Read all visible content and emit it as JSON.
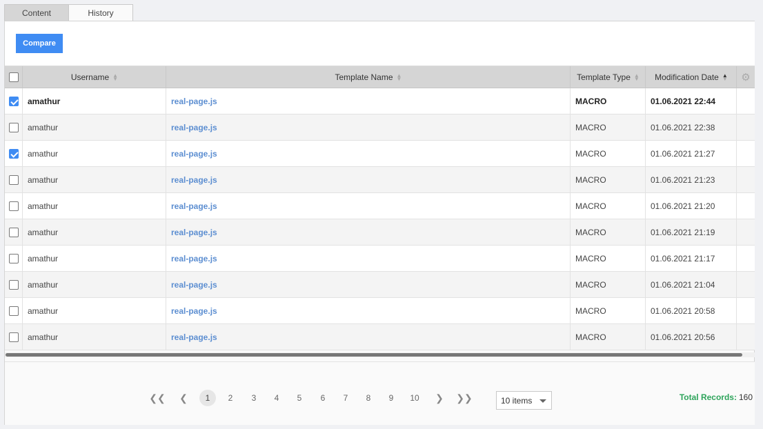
{
  "tabs": [
    {
      "label": "Content"
    },
    {
      "label": "History"
    }
  ],
  "toolbar": {
    "compare_label": "Compare"
  },
  "grid": {
    "columns": {
      "username": "Username",
      "template_name": "Template Name",
      "template_type": "Template Type",
      "modification_date": "Modification Date"
    },
    "rows": [
      {
        "user": "amathur",
        "template": "real-page.js",
        "type": "MACRO",
        "date": "01.06.2021 22:44",
        "checked": true
      },
      {
        "user": "amathur",
        "template": "real-page.js",
        "type": "MACRO",
        "date": "01.06.2021 22:38",
        "checked": false
      },
      {
        "user": "amathur",
        "template": "real-page.js",
        "type": "MACRO",
        "date": "01.06.2021 21:27",
        "checked": true
      },
      {
        "user": "amathur",
        "template": "real-page.js",
        "type": "MACRO",
        "date": "01.06.2021 21:23",
        "checked": false
      },
      {
        "user": "amathur",
        "template": "real-page.js",
        "type": "MACRO",
        "date": "01.06.2021 21:20",
        "checked": false
      },
      {
        "user": "amathur",
        "template": "real-page.js",
        "type": "MACRO",
        "date": "01.06.2021 21:19",
        "checked": false
      },
      {
        "user": "amathur",
        "template": "real-page.js",
        "type": "MACRO",
        "date": "01.06.2021 21:17",
        "checked": false
      },
      {
        "user": "amathur",
        "template": "real-page.js",
        "type": "MACRO",
        "date": "01.06.2021 21:04",
        "checked": false
      },
      {
        "user": "amathur",
        "template": "real-page.js",
        "type": "MACRO",
        "date": "01.06.2021 20:58",
        "checked": false
      },
      {
        "user": "amathur",
        "template": "real-page.js",
        "type": "MACRO",
        "date": "01.06.2021 20:56",
        "checked": false
      }
    ]
  },
  "pager": {
    "first": "❮❮",
    "prev": "❮",
    "next": "❯",
    "last": "❯❯",
    "pages": [
      "1",
      "2",
      "3",
      "4",
      "5",
      "6",
      "7",
      "8",
      "9",
      "10"
    ],
    "active_page": "1",
    "page_size": "10 items",
    "total_label": "Total Records:",
    "total_value": "160"
  },
  "colors": {
    "accent": "#3f8cf3",
    "link": "#5c8ed1",
    "total": "#2ea45b"
  },
  "icons": {
    "settings": "gear-icon",
    "sort": "sort-arrows-icon",
    "dropdown": "chevron-down-icon"
  }
}
